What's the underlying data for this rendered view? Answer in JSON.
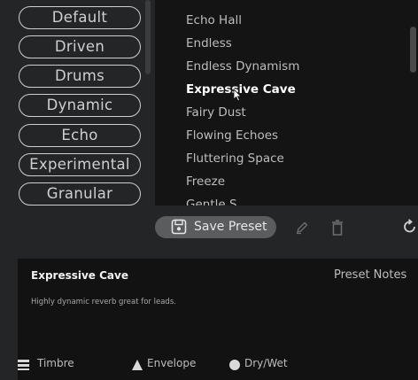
{
  "categories": {
    "items": [
      {
        "label": "Default"
      },
      {
        "label": "Driven"
      },
      {
        "label": "Drums"
      },
      {
        "label": "Dynamic"
      },
      {
        "label": "Echo"
      },
      {
        "label": "Experimental"
      },
      {
        "label": "Granular"
      }
    ]
  },
  "preset_list": {
    "items": [
      {
        "label": "Echo Hall"
      },
      {
        "label": "Endless"
      },
      {
        "label": "Endless Dynamism"
      },
      {
        "label": "Expressive Cave",
        "selected": true
      },
      {
        "label": "Fairy Dust"
      },
      {
        "label": "Flowing Echoes"
      },
      {
        "label": "Fluttering Space"
      },
      {
        "label": "Freeze"
      },
      {
        "label": "Gentle S..."
      }
    ]
  },
  "toolbar": {
    "save_label": "Save Preset",
    "icons": [
      "save-icon",
      "edit-icon",
      "trash-icon",
      "refresh-icon"
    ]
  },
  "notes": {
    "title": "Expressive Cave",
    "label": "Preset Notes",
    "description": "Highly dynamic reverb great for leads.",
    "tags": [
      {
        "label": "Timbre",
        "icon": "bars-icon"
      },
      {
        "label": "Envelope",
        "icon": "triangle-icon"
      },
      {
        "label": "Dry/Wet",
        "icon": "circle-icon"
      }
    ]
  },
  "colors": {
    "background": "#232526",
    "list_background": "#141414",
    "notes_background": "#121212",
    "button_background": "#5a5c5e",
    "text_selected": "#ffffff",
    "text_normal": "#bdbdbd"
  }
}
